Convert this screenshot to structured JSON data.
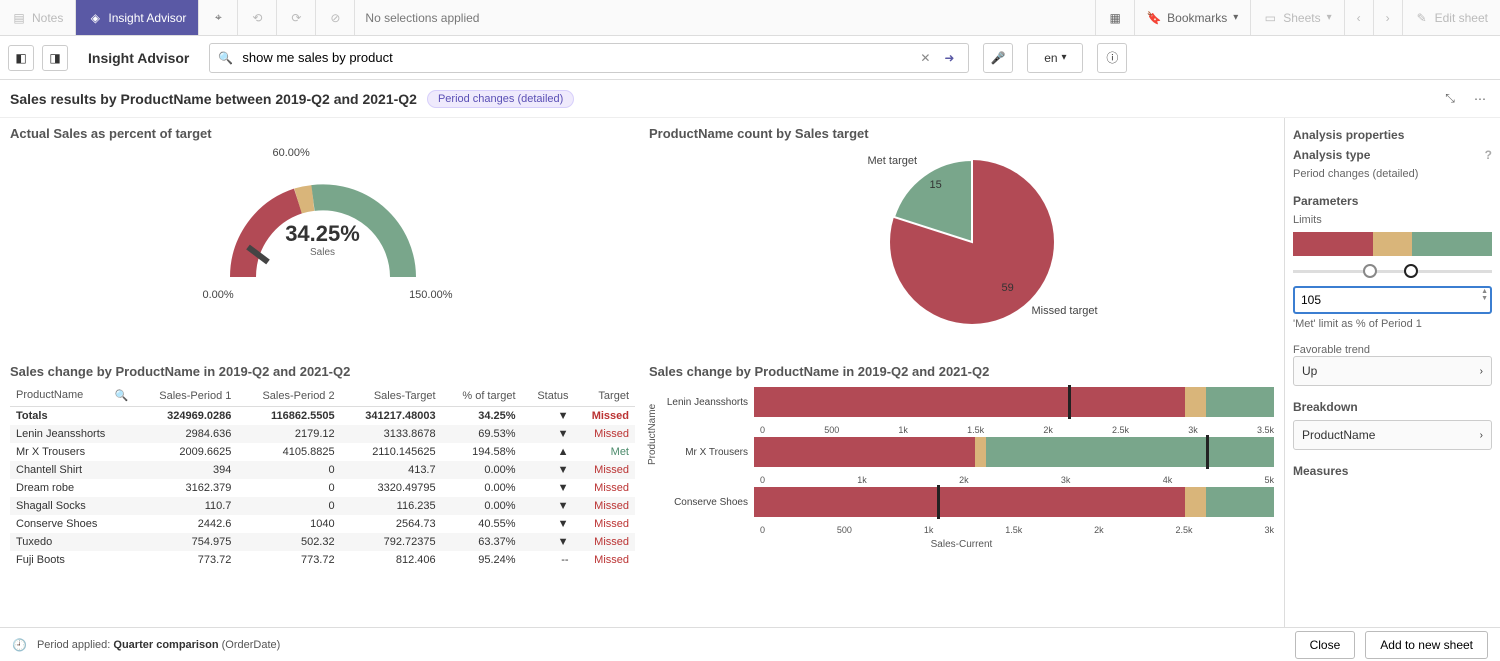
{
  "topbar": {
    "notes": "Notes",
    "insight": "Insight Advisor",
    "no_selections": "No selections applied",
    "bookmarks": "Bookmarks",
    "sheets": "Sheets",
    "edit": "Edit sheet"
  },
  "bar2": {
    "title": "Insight Advisor",
    "search_value": "show me sales by product",
    "lang": "en"
  },
  "header": {
    "title": "Sales results by ProductName between 2019-Q2 and 2021-Q2",
    "badge": "Period changes (detailed)"
  },
  "gauge": {
    "title": "Actual Sales as percent of target",
    "min": "0.00%",
    "mid": "60.00%",
    "max": "150.00%",
    "value": "34.25%",
    "sub": "Sales"
  },
  "pie": {
    "title": "ProductName count by Sales target",
    "met_label": "Met target",
    "missed_label": "Missed target",
    "met_n": "15",
    "missed_n": "59"
  },
  "table": {
    "title": "Sales change by ProductName in 2019-Q2 and 2021-Q2",
    "cols": [
      "ProductName",
      "Sales-Period 1",
      "Sales-Period 2",
      "Sales-Target",
      "% of target",
      "Status",
      "Target"
    ],
    "totals": {
      "name": "Totals",
      "p1": "324969.0286",
      "p2": "116862.5505",
      "tgt": "341217.48003",
      "pct": "34.25%",
      "status": "▼",
      "result": "Missed"
    },
    "rows": [
      {
        "name": "Lenin Jeansshorts",
        "p1": "2984.636",
        "p2": "2179.12",
        "tgt": "3133.8678",
        "pct": "69.53%",
        "status": "▼",
        "result": "Missed"
      },
      {
        "name": "Mr X Trousers",
        "p1": "2009.6625",
        "p2": "4105.8825",
        "tgt": "2110.145625",
        "pct": "194.58%",
        "status": "▲",
        "result": "Met"
      },
      {
        "name": "Chantell Shirt",
        "p1": "394",
        "p2": "0",
        "tgt": "413.7",
        "pct": "0.00%",
        "status": "▼",
        "result": "Missed"
      },
      {
        "name": "Dream robe",
        "p1": "3162.379",
        "p2": "0",
        "tgt": "3320.49795",
        "pct": "0.00%",
        "status": "▼",
        "result": "Missed"
      },
      {
        "name": "Shagall Socks",
        "p1": "110.7",
        "p2": "0",
        "tgt": "116.235",
        "pct": "0.00%",
        "status": "▼",
        "result": "Missed"
      },
      {
        "name": "Conserve Shoes",
        "p1": "2442.6",
        "p2": "1040",
        "tgt": "2564.73",
        "pct": "40.55%",
        "status": "▼",
        "result": "Missed"
      },
      {
        "name": "Tuxedo",
        "p1": "754.975",
        "p2": "502.32",
        "tgt": "792.72375",
        "pct": "63.37%",
        "status": "▼",
        "result": "Missed"
      },
      {
        "name": "Fuji Boots",
        "p1": "773.72",
        "p2": "773.72",
        "tgt": "812.406",
        "pct": "95.24%",
        "status": "--",
        "result": "Missed"
      }
    ]
  },
  "barchart": {
    "title": "Sales change by ProductName in 2019-Q2 and 2021-Q2",
    "ylabel": "ProductName",
    "xlabel": "Sales-Current"
  },
  "props": {
    "heading": "Analysis properties",
    "type_h": "Analysis type",
    "type_v": "Period changes (detailed)",
    "params_h": "Parameters",
    "limits": "Limits",
    "limit_val": "105",
    "limit_caption": "'Met' limit as % of Period 1",
    "trend_h": "Favorable trend",
    "trend_v": "Up",
    "breakdown_h": "Breakdown",
    "breakdown_v": "ProductName",
    "measures_h": "Measures"
  },
  "footer": {
    "period_label": "Period applied:",
    "period_bold": "Quarter comparison",
    "period_rest": "(OrderDate)",
    "close": "Close",
    "add": "Add to new sheet"
  },
  "colors": {
    "red": "#b24a55",
    "tan": "#d9b57a",
    "green": "#79a68b",
    "purple": "#5a59a5"
  },
  "chart_data": [
    {
      "type": "pie",
      "title": "ProductName count by Sales target",
      "series": [
        {
          "name": "Met target",
          "value": 15
        },
        {
          "name": "Missed target",
          "value": 59
        }
      ]
    },
    {
      "type": "bar",
      "title": "Sales change by ProductName in 2019-Q2 and 2021-Q2",
      "xlabel": "Sales-Current",
      "ylabel": "ProductName",
      "categories": [
        "Lenin Jeansshorts",
        "Mr X Trousers",
        "Conserve Shoes"
      ],
      "series": [
        {
          "name": "Sales-Period 1",
          "values": [
            2985,
            2010,
            2443
          ]
        },
        {
          "name": "Sales-Period 2",
          "values": [
            2179,
            4106,
            1040
          ]
        },
        {
          "name": "Sales-Target",
          "values": [
            3134,
            2110,
            2565
          ]
        }
      ],
      "axis_ticks": [
        [
          "0",
          "500",
          "1k",
          "1.5k",
          "2k",
          "2.5k",
          "3k",
          "3.5k"
        ],
        [
          "0",
          "1k",
          "2k",
          "3k",
          "4k",
          "5k"
        ],
        [
          "0",
          "500",
          "1k",
          "1.5k",
          "2k",
          "2.5k",
          "3k"
        ]
      ]
    },
    {
      "type": "table",
      "title": "Sales change by ProductName in 2019-Q2 and 2021-Q2",
      "columns": [
        "ProductName",
        "Sales-Period 1",
        "Sales-Period 2",
        "Sales-Target",
        "% of target",
        "Status",
        "Target"
      ],
      "rows": [
        [
          "Totals",
          324969.0286,
          116862.5505,
          341217.48003,
          34.25,
          "down",
          "Missed"
        ],
        [
          "Lenin Jeansshorts",
          2984.636,
          2179.12,
          3133.8678,
          69.53,
          "down",
          "Missed"
        ],
        [
          "Mr X Trousers",
          2009.6625,
          4105.8825,
          2110.145625,
          194.58,
          "up",
          "Met"
        ],
        [
          "Chantell Shirt",
          394,
          0,
          413.7,
          0.0,
          "down",
          "Missed"
        ],
        [
          "Dream robe",
          3162.379,
          0,
          3320.49795,
          0.0,
          "down",
          "Missed"
        ],
        [
          "Shagall Socks",
          110.7,
          0,
          116.235,
          0.0,
          "down",
          "Missed"
        ],
        [
          "Conserve Shoes",
          2442.6,
          1040,
          2564.73,
          40.55,
          "down",
          "Missed"
        ],
        [
          "Tuxedo",
          754.975,
          502.32,
          792.72375,
          63.37,
          "down",
          "Missed"
        ],
        [
          "Fuji Boots",
          773.72,
          773.72,
          812.406,
          95.24,
          "flat",
          "Missed"
        ]
      ]
    },
    {
      "type": "area",
      "title": "Actual Sales as percent of target",
      "x": [
        0,
        150
      ],
      "ylim": [
        0,
        150
      ],
      "value": 34.25,
      "thresholds": [
        60,
        105
      ]
    }
  ]
}
